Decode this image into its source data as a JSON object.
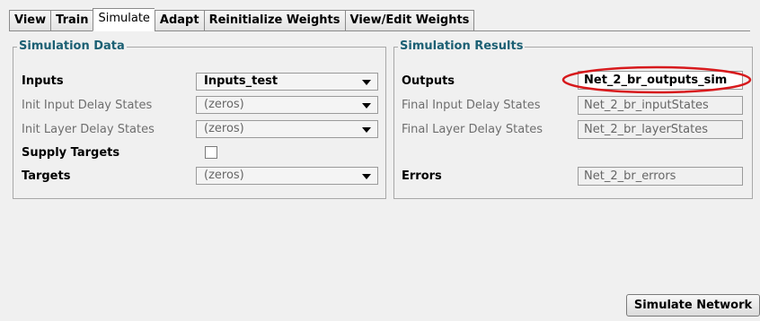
{
  "tabs": [
    {
      "label": "View"
    },
    {
      "label": "Train"
    },
    {
      "label": "Simulate",
      "active": true
    },
    {
      "label": "Adapt"
    },
    {
      "label": "Reinitialize Weights"
    },
    {
      "label": "View/Edit Weights"
    }
  ],
  "simulation_data": {
    "title": "Simulation Data",
    "inputs_label": "Inputs",
    "inputs_value": "Inputs_test",
    "init_input_delay_label": "Init Input Delay States",
    "init_input_delay_value": "(zeros)",
    "init_layer_delay_label": "Init Layer Delay States",
    "init_layer_delay_value": "(zeros)",
    "supply_targets_label": "Supply Targets",
    "supply_targets_checked": false,
    "targets_label": "Targets",
    "targets_value": "(zeros)"
  },
  "simulation_results": {
    "title": "Simulation Results",
    "outputs_label": "Outputs",
    "outputs_value": "Net_2_br_outputs_sim",
    "final_input_delay_label": "Final Input Delay States",
    "final_input_delay_value": "Net_2_br_inputStates",
    "final_layer_delay_label": "Final Layer Delay States",
    "final_layer_delay_value": "Net_2_br_layerStates",
    "errors_label": "Errors",
    "errors_value": "Net_2_br_errors"
  },
  "actions": {
    "simulate_label": "Simulate Network"
  },
  "colors": {
    "group_title": "#1b5f73",
    "highlight_oval": "#d7191c"
  }
}
